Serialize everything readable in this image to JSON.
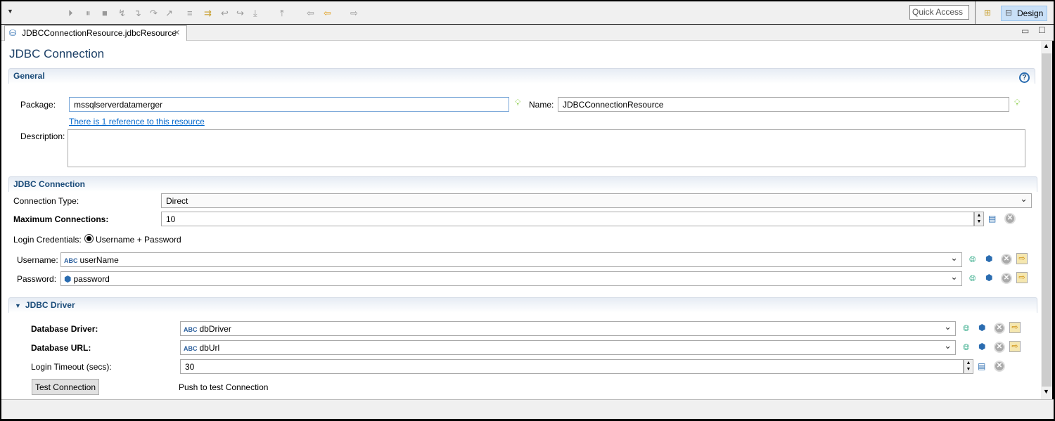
{
  "toolbar": {
    "quick_access": "Quick Access",
    "design": "Design"
  },
  "tab": {
    "label": "JDBCConnectionResource.jdbcResource"
  },
  "page_title": "JDBC Connection",
  "general": {
    "title": "General",
    "package_label": "Package:",
    "package_value": "mssqlserverdatamerger",
    "name_label": "Name:",
    "name_value": "JDBCConnectionResource",
    "reference_link": "There is 1 reference to this resource",
    "description_label": "Description:",
    "description_value": ""
  },
  "jdbc_connection": {
    "title": "JDBC Connection",
    "type_label": "Connection Type:",
    "type_value": "Direct",
    "max_label": "Maximum Connections:",
    "max_value": "10",
    "cred_label": "Login Credentials:",
    "cred_option": "Username + Password",
    "username_label": "Username:",
    "username_value": "userName",
    "password_label": "Password:",
    "password_value": "password"
  },
  "jdbc_driver": {
    "title": "JDBC Driver",
    "driver_label": "Database Driver:",
    "driver_value": "dbDriver",
    "url_label": "Database URL:",
    "url_value": "dbUrl",
    "timeout_label": "Login Timeout (secs):",
    "timeout_value": "30",
    "test_button": "Test Connection",
    "test_hint": "Push to test Connection"
  },
  "colors": {
    "accent": "#1b4c7a",
    "link": "#0066cc"
  }
}
